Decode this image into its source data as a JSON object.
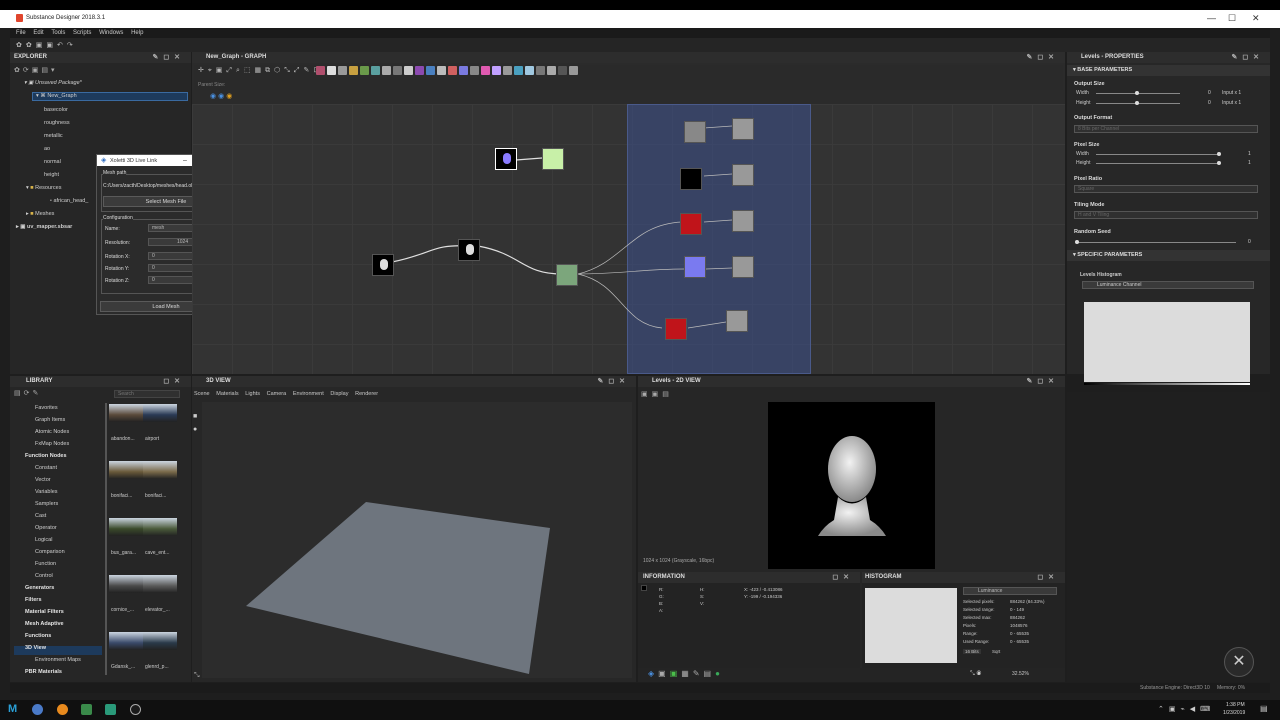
{
  "window": {
    "title": "Substance Designer 2018.3.1",
    "min": "—",
    "max": "☐",
    "close": "✕"
  },
  "menu": [
    "File",
    "Edit",
    "Tools",
    "Scripts",
    "Windows",
    "Help"
  ],
  "explorer": {
    "title": "EXPLORER",
    "package": "Unsaved Package*",
    "graph": "New_Graph",
    "outputs": [
      "basecolor",
      "roughness",
      "metallic",
      "ao",
      "normal",
      "height"
    ],
    "resources": "Resources",
    "resource_file": "african_head_",
    "meshes": "Meshes",
    "uv_package": "uv_mapper.sbsar"
  },
  "graph_panel": {
    "title": "New_Graph - GRAPH",
    "parent_size_label": "Parent Size:"
  },
  "livelink": {
    "title": "Xoletti 3D Live Link",
    "mesh_path_group": "Mesh path",
    "mesh_path": "C:/Users/zacth/Desktop/meshes/head.obj",
    "select_btn": "Select Mesh File",
    "config_group": "Configuration",
    "name_label": "Name:",
    "name_value": "mesh",
    "res_label": "Resolution:",
    "res_value": "1024",
    "rotx_label": "Rotation X:",
    "rotx_value": "0",
    "roty_label": "Rotation Y:",
    "roty_value": "0",
    "rotz_label": "Rotation Z:",
    "rotz_value": "0",
    "load_btn": "Load Mesh"
  },
  "properties": {
    "title": "Levels - PROPERTIES",
    "base_params": "BASE PARAMETERS",
    "output_size": "Output Size",
    "width": "Width",
    "height": "Height",
    "width_val": "0",
    "height_val": "0",
    "width_mode": "Input x 1",
    "height_mode": "Input x 1",
    "output_format": "Output Format",
    "output_format_val": "8 Bits per Channel",
    "pixel_size": "Pixel Size",
    "ps_width": "Width",
    "ps_height": "Height",
    "ps_width_val": "1",
    "ps_height_val": "1",
    "pixel_ratio": "Pixel Ratio",
    "pixel_ratio_val": "Square",
    "tiling_mode": "Tiling Mode",
    "tiling_mode_val": "H and V Tiling",
    "random_seed": "Random Seed",
    "random_seed_val": "0",
    "specific_params": "SPECIFIC PARAMETERS",
    "histogram_label": "Levels Histogram",
    "channel": "Luminance Channel"
  },
  "library": {
    "title": "LIBRARY",
    "search_placeholder": "Search",
    "items": [
      {
        "label": "Favorites",
        "bold": false
      },
      {
        "label": "Graph Items",
        "bold": false
      },
      {
        "label": "Atomic Nodes",
        "bold": false
      },
      {
        "label": "FxMap Nodes",
        "bold": false
      },
      {
        "label": "Function Nodes",
        "bold": true
      },
      {
        "label": "Constant",
        "bold": false
      },
      {
        "label": "Vector",
        "bold": false
      },
      {
        "label": "Variables",
        "bold": false
      },
      {
        "label": "Samplers",
        "bold": false
      },
      {
        "label": "Cast",
        "bold": false
      },
      {
        "label": "Operator",
        "bold": false
      },
      {
        "label": "Logical",
        "bold": false
      },
      {
        "label": "Comparison",
        "bold": false
      },
      {
        "label": "Function",
        "bold": false
      },
      {
        "label": "Control",
        "bold": false
      },
      {
        "label": "Generators",
        "bold": true
      },
      {
        "label": "Filters",
        "bold": true
      },
      {
        "label": "Material Filters",
        "bold": true
      },
      {
        "label": "Mesh Adaptive",
        "bold": true
      },
      {
        "label": "Functions",
        "bold": true
      },
      {
        "label": "3D View",
        "bold": true
      },
      {
        "label": "Environment Maps",
        "bold": false
      },
      {
        "label": "PBR Materials",
        "bold": true
      }
    ],
    "thumbs": [
      "abandon...",
      "airport",
      "bonifaci...",
      "bonifaci...",
      "bus_gara...",
      "cave_ent...",
      "cornice_...",
      "elevator_...",
      "Gdansk_...",
      "glenrd_p..."
    ]
  },
  "view3d": {
    "title": "3D VIEW",
    "menu": [
      "Scene",
      "Materials",
      "Lights",
      "Camera",
      "Environment",
      "Display",
      "Renderer"
    ]
  },
  "view2d": {
    "title": "Levels - 2D VIEW",
    "status": "1024 x 1024 (Grayscale, 16bpc)",
    "zoom": "32.52%"
  },
  "information": {
    "title": "INFORMATION",
    "r": "R:",
    "g": "G:",
    "b": "B:",
    "a": "A:",
    "h": "H:",
    "s": "S:",
    "v": "V:",
    "x_readout": "X: -423 / -0.413086",
    "y_readout": "Y: -199 / -0.194336"
  },
  "histogram": {
    "title": "HISTOGRAM",
    "channel": "Luminance",
    "rows": [
      {
        "k": "Selected pixels:",
        "v": "884262 (84.33%)"
      },
      {
        "k": "Selected range:",
        "v": "0 - 149"
      },
      {
        "k": "Selected max:",
        "v": "884262"
      },
      {
        "k": "Pixels:",
        "v": "1048576"
      },
      {
        "k": "Range:",
        "v": "0 - 65535"
      },
      {
        "k": "Used Range:",
        "v": "0 - 65535"
      }
    ],
    "bits": "16 Bits",
    "sqrt": "Sqrt"
  },
  "statusbar": {
    "engine": "Substance Engine: Direct3D 10",
    "memory": "Memory: 0%"
  },
  "taskbar": {
    "time": "1:38 PM",
    "date": "1/23/2019"
  }
}
